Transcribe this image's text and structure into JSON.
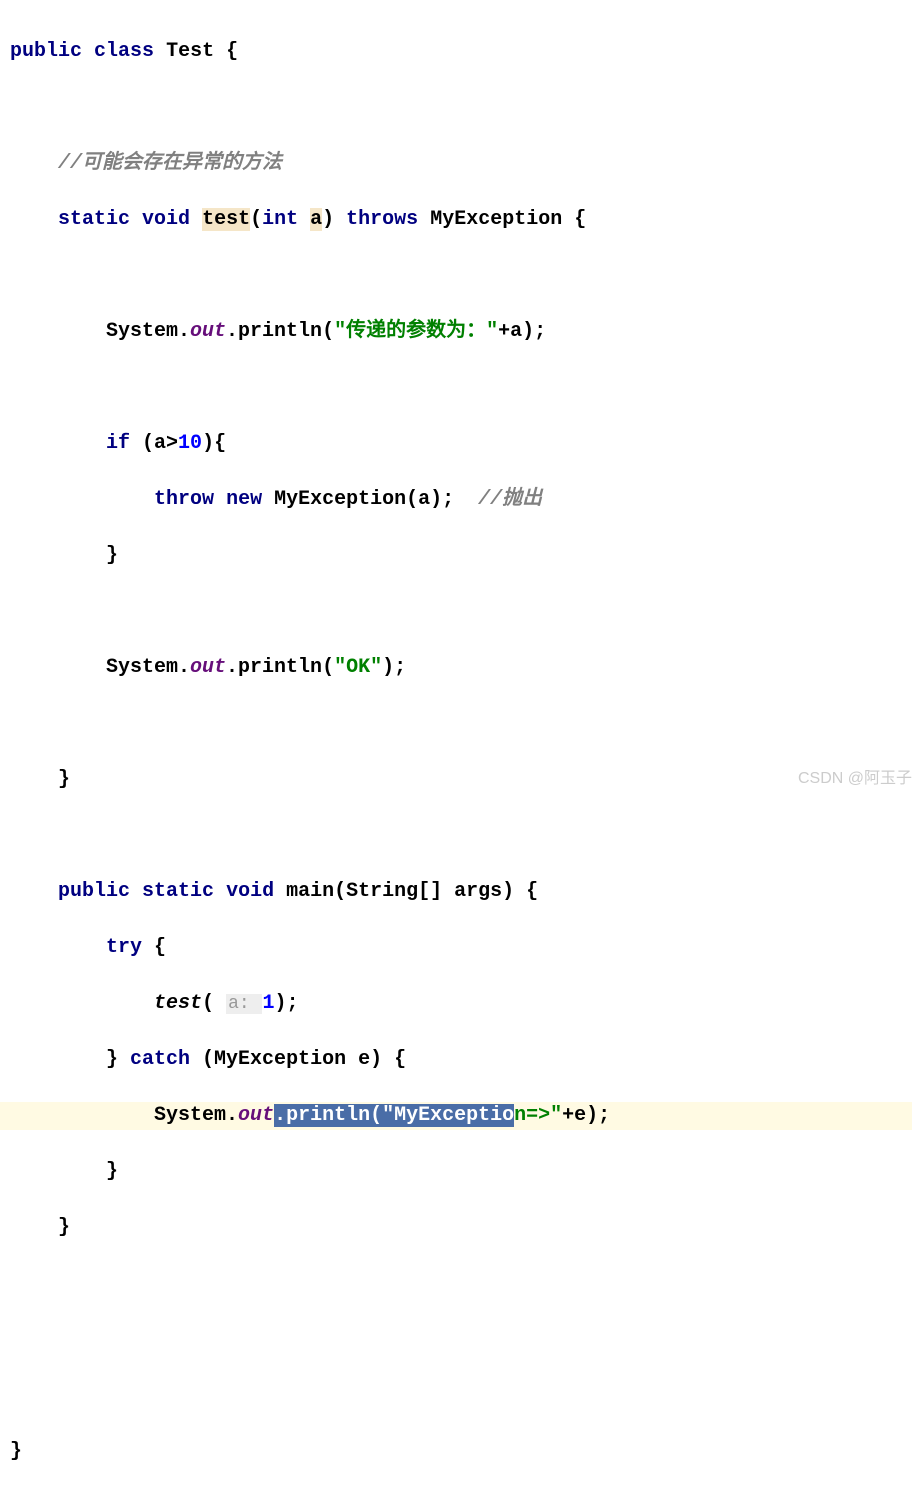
{
  "code": {
    "line1": {
      "kw1": "public",
      "kw2": "class",
      "className": "Test",
      "brace": " {"
    },
    "comment1": "//可能会存在异常的方法",
    "method1": {
      "kw1": "static",
      "kw2": "void",
      "methodName": "test",
      "paren1": "(",
      "kw3": "int",
      "param": "a",
      "paren2": ") ",
      "kw4": "throws",
      "exception": " MyException {"
    },
    "print1": {
      "prefix": "System.",
      "out": "out",
      "method": ".println(",
      "str": "\"传递的参数为：\"",
      "suffix": "+a);"
    },
    "if1": {
      "kw": "if",
      "cond1": " (a>",
      "num": "10",
      "cond2": "){"
    },
    "throw1": {
      "kw1": "throw",
      "kw2": "new",
      "rest": " MyException(a);  ",
      "comment": "//抛出"
    },
    "closeBrace1": "}",
    "print2": {
      "prefix": "System.",
      "out": "out",
      "method": ".println(",
      "str": "\"OK\"",
      "suffix": ");"
    },
    "closeBrace2": "}",
    "main": {
      "kw1": "public",
      "kw2": "static",
      "kw3": "void",
      "methodName": "main",
      "params": "(String[] args) {"
    },
    "try1": {
      "kw": "try",
      "brace": " {"
    },
    "testCall": {
      "method": "test",
      "paren1": "( ",
      "hint": "a: ",
      "num": "1",
      "paren2": ");"
    },
    "catch1": {
      "brace1": "} ",
      "kw": "catch",
      "params": " (MyException e) {"
    },
    "print3": {
      "prefix": "System.",
      "out": "out",
      "selStart": ".println(",
      "selStr1": "\"MyExceptio",
      "afterSel1": "n=>\"",
      "suffix": "+e);"
    },
    "closeBrace3": "}",
    "closeBrace4": "}",
    "closeBrace5": "}"
  },
  "watermark": "CSDN @阿玉子"
}
